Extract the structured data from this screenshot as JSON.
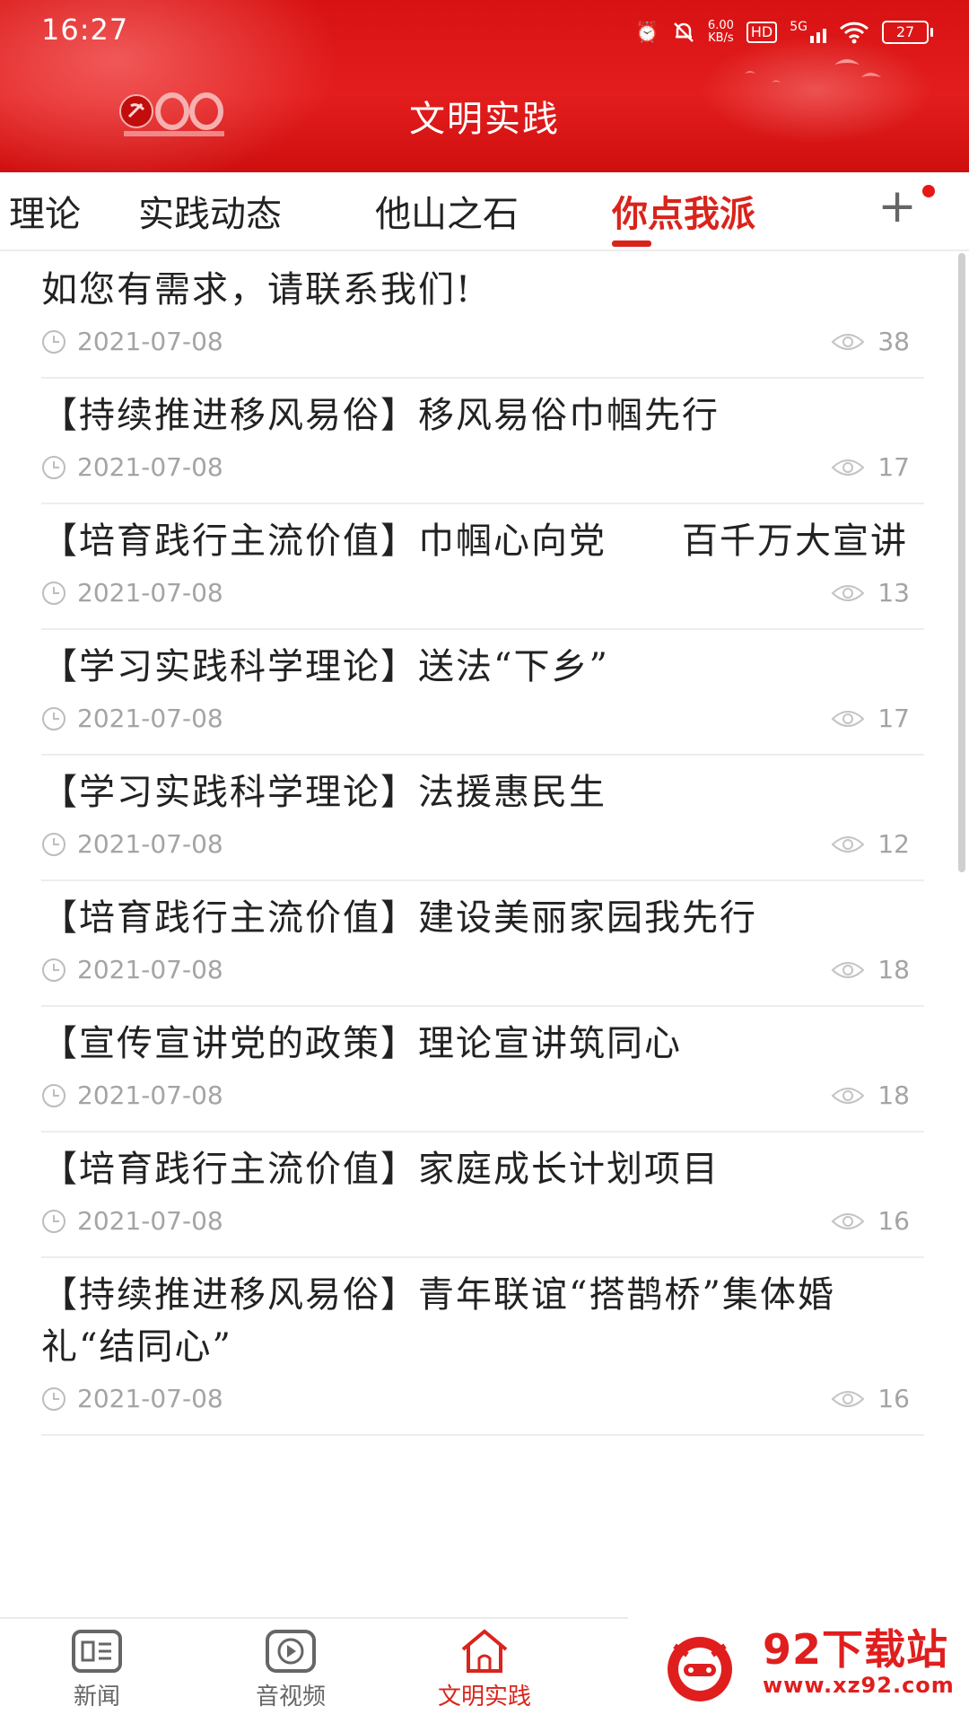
{
  "status_bar": {
    "time": "16:27",
    "net_speed_value": "6.00",
    "net_speed_unit": "KB/s",
    "hd_label": "HD",
    "signal_label": "5G",
    "battery": "27"
  },
  "header": {
    "title": "文明实践"
  },
  "tabs": [
    {
      "label": "理论"
    },
    {
      "label": "实践动态"
    },
    {
      "label": "他山之石"
    },
    {
      "label": "你点我派"
    }
  ],
  "add_tab_label": "+",
  "articles": [
    {
      "title": "如您有需求，请联系我们!",
      "date": "2021-07-08",
      "views": "38"
    },
    {
      "title": "【持续推进移风易俗】移风易俗巾帼先行",
      "date": "2021-07-08",
      "views": "17"
    },
    {
      "title": "【培育践行主流价值】巾帼心向党　　百千万大宣讲",
      "date": "2021-07-08",
      "views": "13"
    },
    {
      "title": "【学习实践科学理论】送法“下乡”",
      "date": "2021-07-08",
      "views": "17"
    },
    {
      "title": "【学习实践科学理论】法援惠民生",
      "date": "2021-07-08",
      "views": "12"
    },
    {
      "title": "【培育践行主流价值】建设美丽家园我先行",
      "date": "2021-07-08",
      "views": "18"
    },
    {
      "title": "【宣传宣讲党的政策】理论宣讲筑同心",
      "date": "2021-07-08",
      "views": "18"
    },
    {
      "title": "【培育践行主流价值】家庭成长计划项目",
      "date": "2021-07-08",
      "views": "16"
    },
    {
      "title": "【持续推进移风易俗】青年联谊“搭鹊桥”集体婚礼“结同心”",
      "date": "2021-07-08",
      "views": "16"
    }
  ],
  "bottom_nav": [
    {
      "label": "新闻",
      "icon": "news-icon"
    },
    {
      "label": "音视频",
      "icon": "video-icon"
    },
    {
      "label": "文明实践",
      "icon": "home-icon",
      "active": true
    }
  ],
  "watermark": {
    "name": "92下载站",
    "url": "www.xz92.com"
  },
  "colors": {
    "accent": "#d9241b",
    "header_red": "#e31d1d",
    "meta_gray": "#a4a4a4"
  }
}
